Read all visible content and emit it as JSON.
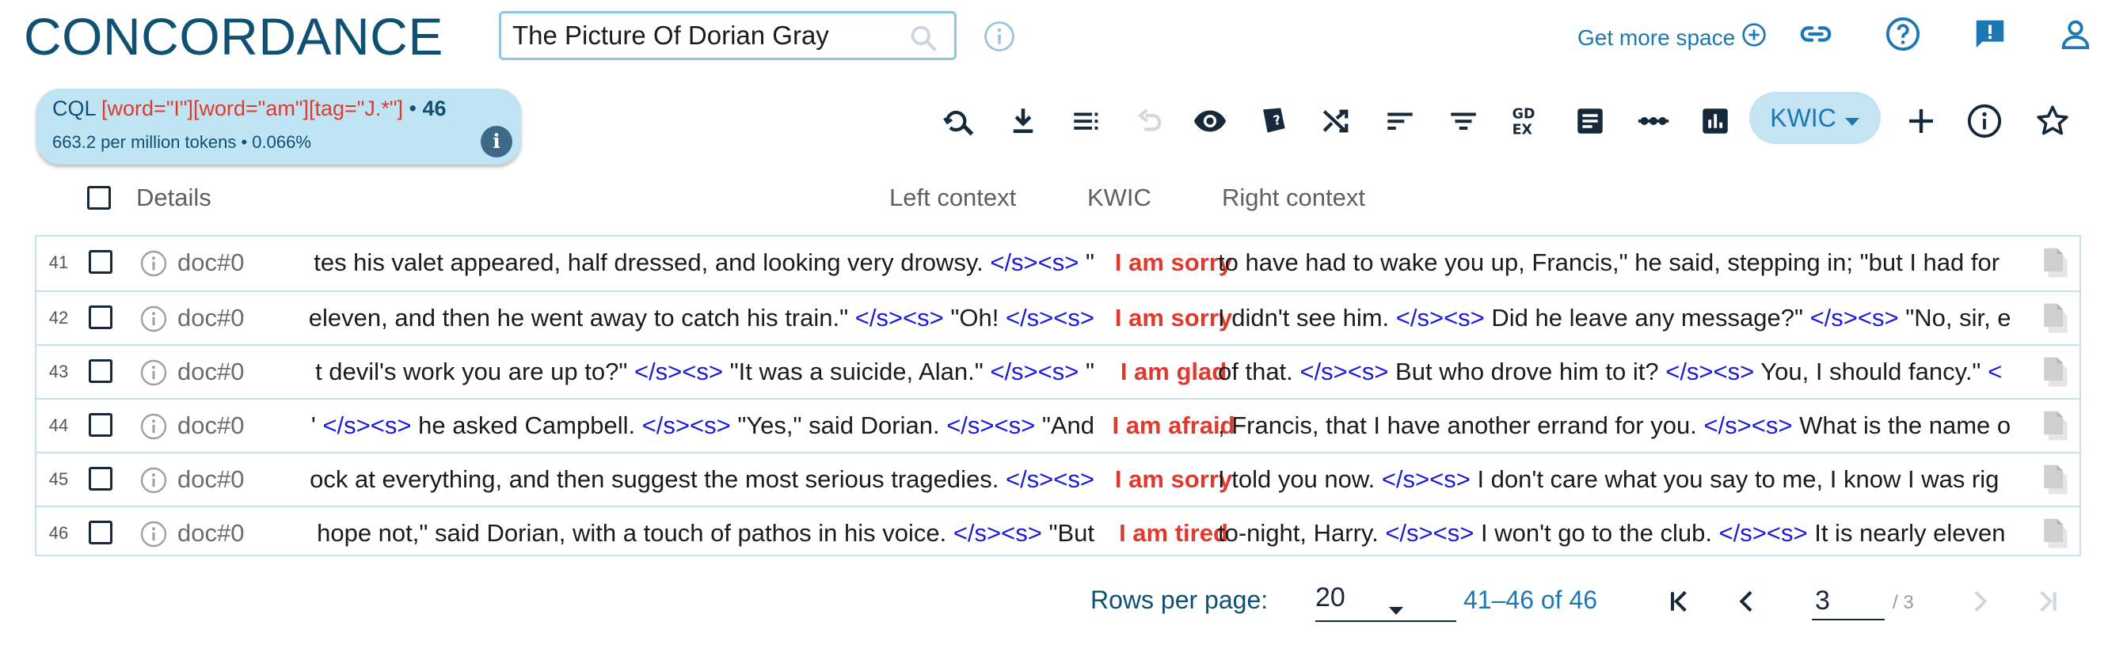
{
  "app": {
    "title": "CONCORDANCE",
    "search_value": "The Picture Of Dorian Gray",
    "get_more_space": "Get more space"
  },
  "cql": {
    "prefix": "CQL",
    "query": "[word=\"I\"][word=\"am\"][tag=\"J.*\"]",
    "separator": "•",
    "count": "46",
    "stats": "663.2 per million tokens • 0.066%"
  },
  "toolbar": {
    "view_mode": "KWIC",
    "icons": [
      "search-refresh-icon",
      "download-icon",
      "list-settings-icon",
      "undo-icon",
      "visibility-icon",
      "dictionary-icon",
      "shuffle-icon",
      "sort-icon",
      "filter-icon",
      "gdex-icon",
      "summary-icon",
      "frequency-dots-icon",
      "bar-chart-icon",
      "add-icon",
      "info-icon",
      "star-icon"
    ]
  },
  "table": {
    "headers": {
      "details": "Details",
      "left": "Left context",
      "kwic": "KWIC",
      "right": "Right context"
    },
    "rows": [
      {
        "num": "41",
        "doc": "doc#0",
        "left": [
          [
            "t",
            "tes his valet appeared, half dressed, and looking very drowsy. "
          ],
          [
            "s",
            "</s><s>"
          ],
          [
            "t",
            " \""
          ]
        ],
        "kwic": "I am sorry",
        "right": [
          [
            "t",
            "to have had to wake you up, Francis,\" he said, stepping in; \"but I had for"
          ]
        ]
      },
      {
        "num": "42",
        "doc": "doc#0",
        "left": [
          [
            "t",
            "eleven, and then he went away to catch his train.\" "
          ],
          [
            "s",
            "</s><s>"
          ],
          [
            "t",
            " \"Oh! "
          ],
          [
            "s",
            "</s><s>"
          ]
        ],
        "kwic": "I am sorry",
        "right": [
          [
            "t",
            "I didn't see him. "
          ],
          [
            "s",
            "</s><s>"
          ],
          [
            "t",
            " Did he leave any message?\" "
          ],
          [
            "s",
            "</s><s>"
          ],
          [
            "t",
            " \"No, sir, e"
          ]
        ]
      },
      {
        "num": "43",
        "doc": "doc#0",
        "left": [
          [
            "t",
            "t devil's work you are up to?\" "
          ],
          [
            "s",
            "</s><s>"
          ],
          [
            "t",
            " \"It was a suicide, Alan.\" "
          ],
          [
            "s",
            "</s><s>"
          ],
          [
            "t",
            " \""
          ]
        ],
        "kwic": "I am glad",
        "right": [
          [
            "t",
            "of that. "
          ],
          [
            "s",
            "</s><s>"
          ],
          [
            "t",
            " But who drove him to it? "
          ],
          [
            "s",
            "</s><s>"
          ],
          [
            "t",
            " You, I should fancy.\" "
          ],
          [
            "s",
            "<"
          ]
        ]
      },
      {
        "num": "44",
        "doc": "doc#0",
        "left": [
          [
            "t",
            "' "
          ],
          [
            "s",
            "</s><s>"
          ],
          [
            "t",
            " he asked Campbell. "
          ],
          [
            "s",
            "</s><s>"
          ],
          [
            "t",
            " \"Yes,\" said Dorian. "
          ],
          [
            "s",
            "</s><s>"
          ],
          [
            "t",
            " \"And"
          ]
        ],
        "kwic": "I am afraid",
        "right": [
          [
            "t",
            ", Francis, that I have another errand for you. "
          ],
          [
            "s",
            "</s><s>"
          ],
          [
            "t",
            " What is the name o"
          ]
        ]
      },
      {
        "num": "45",
        "doc": "doc#0",
        "left": [
          [
            "t",
            "ock at everything, and then suggest the most serious tragedies. "
          ],
          [
            "s",
            "</s><s>"
          ]
        ],
        "kwic": "I am sorry",
        "right": [
          [
            "t",
            "I told you now. "
          ],
          [
            "s",
            "</s><s>"
          ],
          [
            "t",
            " I don't care what you say to me, I know I was rig"
          ]
        ]
      },
      {
        "num": "46",
        "doc": "doc#0",
        "left": [
          [
            "t",
            "hope not,\" said Dorian, with a touch of pathos in his voice. "
          ],
          [
            "s",
            "</s><s>"
          ],
          [
            "t",
            " \"But"
          ]
        ],
        "kwic": "I am tired",
        "right": [
          [
            "t",
            "to-night, Harry. "
          ],
          [
            "s",
            "</s><s>"
          ],
          [
            "t",
            " I won't go to the club. "
          ],
          [
            "s",
            "</s><s>"
          ],
          [
            "t",
            " It is nearly eleven"
          ]
        ]
      }
    ]
  },
  "pagination": {
    "rows_per_page_label": "Rows per page:",
    "rows_per_page": "20",
    "range": "41–46 of 46",
    "page": "3",
    "total": "/ 3"
  },
  "colors": {
    "brand": "#0e5173",
    "accent": "#1b78b4",
    "kwic": "#e03a2e",
    "tag": "#1a1ad8",
    "card": "#bfe4f3"
  }
}
